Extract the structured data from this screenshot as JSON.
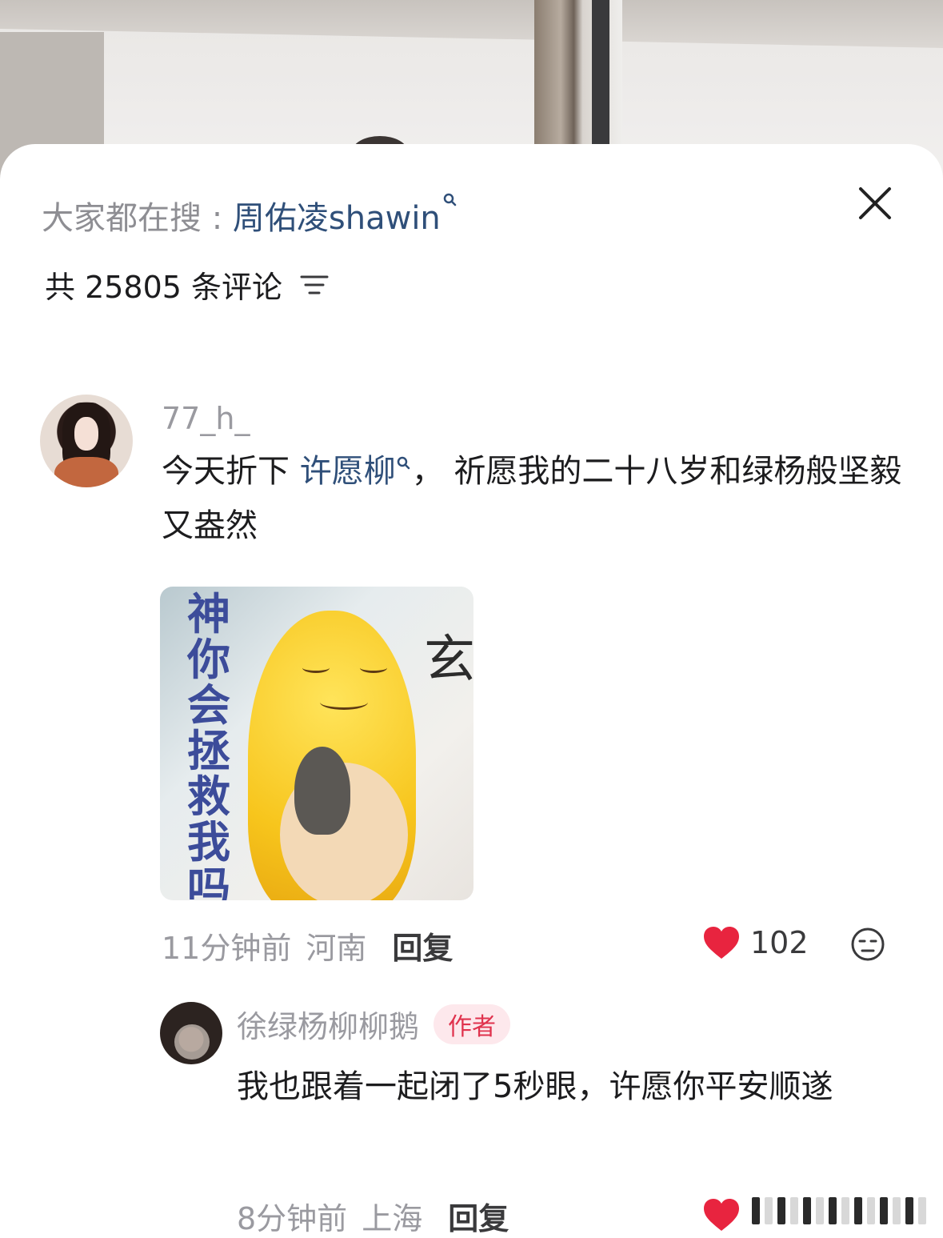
{
  "header": {
    "search_prefix": "大家都在搜 : ",
    "search_term": "周佑凌shawin",
    "comment_count_label": "共 25805 条评论"
  },
  "comments": [
    {
      "username": "77_h_",
      "text_before": "今天折下 ",
      "link": "许愿柳",
      "text_after": "， 祈愿我的二十八岁和绿杨般坚毅又盎然",
      "sticker_text": [
        "神",
        "你",
        "会",
        "拯",
        "救",
        "我",
        "吗"
      ],
      "time": "11分钟前",
      "region": "河南",
      "reply_label": "回复",
      "likes": "102"
    }
  ],
  "reply": {
    "username": "徐绿杨柳柳鹅",
    "badge": "作者",
    "text": "我也跟着一起闭了5秒眼，许愿你平安顺遂",
    "time": "8分钟前",
    "region": "上海",
    "reply_label": "回复"
  },
  "colors": {
    "link": "#2f4f79",
    "like_heart": "#e8243f",
    "badge_bg": "#fde8ec",
    "badge_text": "#e0324d"
  }
}
